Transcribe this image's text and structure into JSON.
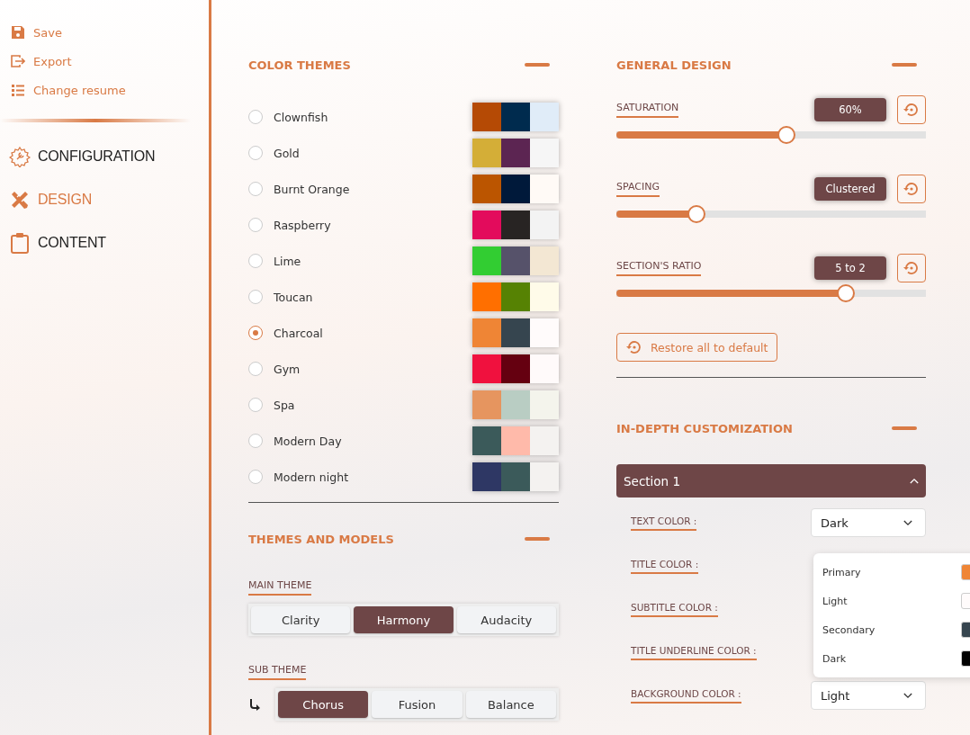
{
  "sidebar": {
    "actions": [
      {
        "label": "Save"
      },
      {
        "label": "Export"
      },
      {
        "label": "Change resume"
      }
    ],
    "nav": [
      {
        "label": "CONFIGURATION",
        "selected": false
      },
      {
        "label": "DESIGN",
        "selected": true
      },
      {
        "label": "CONTENT",
        "selected": false
      }
    ]
  },
  "color_themes": {
    "title": "COLOR THEMES",
    "themes": [
      {
        "name": "Clownfish",
        "selected": false,
        "swatch": [
          {
            "color": "#b54a05"
          },
          {
            "color": "#002b4e"
          },
          {
            "color": "#e0ecf8"
          }
        ]
      },
      {
        "name": "Gold",
        "selected": false,
        "swatch": [
          {
            "color": "#d4ae37"
          },
          {
            "color": "#5c2552"
          },
          {
            "color": "#f6f6f6"
          }
        ]
      },
      {
        "name": "Burnt Orange",
        "selected": false,
        "swatch": [
          {
            "color": "#bb5500"
          },
          {
            "color": "#00193a"
          },
          {
            "color": "#fffaf6"
          }
        ]
      },
      {
        "name": "Raspberry",
        "selected": false,
        "swatch": [
          {
            "color": "#e30b5c"
          },
          {
            "color": "#282423"
          },
          {
            "color": "#f3f3f3"
          }
        ]
      },
      {
        "name": "Lime",
        "selected": false,
        "swatch": [
          {
            "color": "#32cd32"
          },
          {
            "color": "#56526a"
          },
          {
            "color": "#f3e7d3"
          }
        ]
      },
      {
        "name": "Toucan",
        "selected": false,
        "swatch": [
          {
            "color": "#ff6f00"
          },
          {
            "color": "#568203"
          },
          {
            "color": "#fffbe9"
          }
        ]
      },
      {
        "name": "Charcoal",
        "selected": true,
        "swatch": [
          {
            "color": "#ef8535"
          },
          {
            "color": "#36454f"
          },
          {
            "color": "#fffbfb"
          }
        ]
      },
      {
        "name": "Gym",
        "selected": false,
        "swatch": [
          {
            "color": "#f0113e"
          },
          {
            "color": "#650010"
          },
          {
            "color": "#fffafa"
          }
        ]
      },
      {
        "name": "Spa",
        "selected": false,
        "swatch": [
          {
            "color": "#e6955f"
          },
          {
            "color": "#b9cdc3"
          },
          {
            "color": "#f4f4ec"
          }
        ]
      },
      {
        "name": "Modern Day",
        "selected": false,
        "swatch": [
          {
            "color": "#3b5a5a"
          },
          {
            "color": "#ffbaaa"
          },
          {
            "color": "#f4f2f0"
          }
        ]
      },
      {
        "name": "Modern night",
        "selected": false,
        "swatch": [
          {
            "color": "#2e3764"
          },
          {
            "color": "#3b5a5a"
          },
          {
            "color": "#f4f2f0"
          }
        ]
      }
    ]
  },
  "themes_and_models": {
    "title": "THEMES AND MODELS",
    "groups": [
      {
        "label": "MAIN THEME",
        "options": [
          {
            "label": "Clarity",
            "selected": false
          },
          {
            "label": "Harmony",
            "selected": true
          },
          {
            "label": "Audacity",
            "selected": false
          }
        ]
      },
      {
        "label": "SUB THEME",
        "options": [
          {
            "label": "Chorus",
            "selected": true
          },
          {
            "label": "Fusion",
            "selected": false
          },
          {
            "label": "Balance",
            "selected": false
          }
        ]
      }
    ]
  },
  "general_design": {
    "title": "GENERAL DESIGN",
    "sliders": [
      {
        "label": "SATURATION",
        "value": "60%",
        "level": 0.55
      },
      {
        "label": "SPACING",
        "value": "Clustered",
        "level": 0.26
      },
      {
        "label": "SECTION'S RATIO",
        "value": "5 to 2",
        "level": 0.74
      }
    ],
    "restore_button": "Restore all to default"
  },
  "in_depth": {
    "title": "IN-DEPTH CUSTOMIZATION",
    "section": {
      "title": "Section 1",
      "expanded": true
    },
    "rows": [
      {
        "label": "TEXT COLOR :",
        "value": "Dark"
      },
      {
        "label": "TITLE COLOR :"
      },
      {
        "label": "SUBTITLE COLOR :"
      },
      {
        "label": "TITLE UNDERLINE COLOR :"
      },
      {
        "label": "BACKGROUND COLOR :",
        "value": "Light"
      }
    ],
    "dropdown_menu": {
      "options": [
        {
          "label": "Primary",
          "color": "#ef8535"
        },
        {
          "label": "Light",
          "color": "#fffbfb"
        },
        {
          "label": "Secondary",
          "color": "#36454f"
        },
        {
          "label": "Dark",
          "color": "#000000"
        }
      ]
    }
  }
}
